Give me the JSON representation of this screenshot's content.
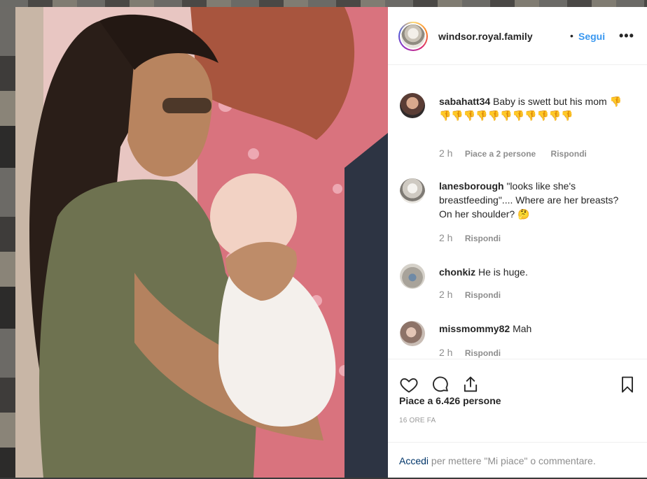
{
  "post": {
    "username": "windsor.royal.family",
    "separator": "•",
    "follow_label": "Segui",
    "more_icon": "more-icon",
    "more_label": "•••"
  },
  "comments": [
    {
      "username": "sabahatt34",
      "text": "Baby is swett but his mom 👎👎👎👎👎👎👎👎👎👎👎👎",
      "time": "2 h",
      "likes": "Piace a 2 persone",
      "reply": "Rispondi"
    },
    {
      "username": "lanesborough",
      "text": "\"looks like she's breastfeeding\".... Where are her breasts? On her shoulder? 🤔",
      "time": "2 h",
      "reply": "Rispondi"
    },
    {
      "username": "chonkiz",
      "text": "He is huge.",
      "time": "2 h",
      "reply": "Rispondi"
    },
    {
      "username": "missmommy82",
      "text": "Mah",
      "time": "2 h",
      "reply": "Rispondi"
    }
  ],
  "actions": {
    "like_icon": "heart-icon",
    "comment_icon": "comment-icon",
    "share_icon": "share-icon",
    "save_icon": "bookmark-icon",
    "likes_text": "Piace a 6.426 persone",
    "time_ago": "16 ORE FA"
  },
  "login": {
    "link": "Accedi",
    "rest": "per mettere \"Mi piace\" o commentare."
  },
  "colors": {
    "accent": "#3897f0",
    "link_dark": "#003569",
    "muted": "#8e8e8e"
  }
}
